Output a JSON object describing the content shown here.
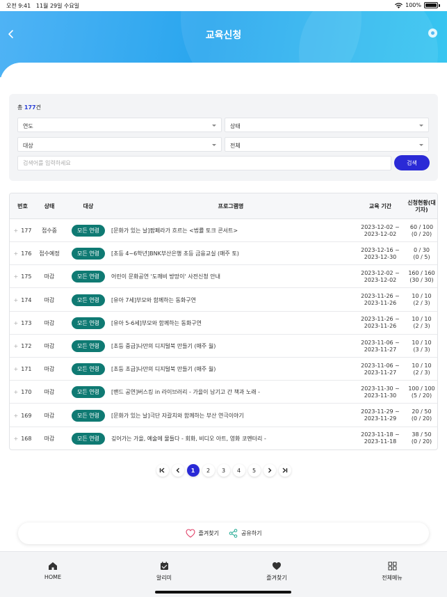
{
  "status_bar": {
    "time": "오전 9:41",
    "date": "11월 29일 수요일",
    "battery": "100%"
  },
  "header": {
    "title": "교육신청"
  },
  "filter": {
    "total_prefix": "총",
    "total_count": "177",
    "total_suffix": "건",
    "year_select": "연도",
    "status_select": "상태",
    "target_select": "대상",
    "all_select": "전체",
    "search_placeholder": "검색어를 입력하세요",
    "search_button": "검색"
  },
  "table": {
    "headers": {
      "no": "번호",
      "status": "상태",
      "target": "대상",
      "program": "프로그램명",
      "period": "교육 기간",
      "application": "신청현황(대기자)"
    },
    "rows": [
      {
        "no": "177",
        "status": "접수중",
        "target": "모든 연령",
        "title": "[문화가 있는 날]팝페라가 흐르는 <법률 토크 콘서트>",
        "start": "2023-12-02 ~",
        "end": "2023-12-02",
        "count": "60 / 100",
        "wait": "(0 / 20)"
      },
      {
        "no": "176",
        "status": "접수예정",
        "target": "모든 연령",
        "title": "[초등 4~6학년]BNK부산은행 초등 금융교실 (매주 토)",
        "start": "2023-12-16 ~",
        "end": "2023-12-30",
        "count": "0 / 30",
        "wait": "(0 / 5)"
      },
      {
        "no": "175",
        "status": "마감",
        "target": "모든 연령",
        "title": "어린이 문화공연 '도깨비 방망이' 사전신청 안내",
        "start": "2023-12-02 ~",
        "end": "2023-12-02",
        "count": "160 / 160",
        "wait": "(30 / 30)"
      },
      {
        "no": "174",
        "status": "마감",
        "target": "모든 연령",
        "title": "[유아 7세]부모와 함께하는 동화구연",
        "start": "2023-11-26 ~",
        "end": "2023-11-26",
        "count": "10 / 10",
        "wait": "(2 / 3)"
      },
      {
        "no": "173",
        "status": "마감",
        "target": "모든 연령",
        "title": "[유아 5-6세]부모와 함께하는 동화구연",
        "start": "2023-11-26 ~",
        "end": "2023-11-26",
        "count": "10 / 10",
        "wait": "(2 / 3)"
      },
      {
        "no": "172",
        "status": "마감",
        "target": "모든 연령",
        "title": "[초등 중급]나만의 디지털북 만들기 (매주 월)",
        "start": "2023-11-06 ~",
        "end": "2023-11-27",
        "count": "10 / 10",
        "wait": "(3 / 3)"
      },
      {
        "no": "171",
        "status": "마감",
        "target": "모든 연령",
        "title": "[초등 초급]나만의 디지털북 만들기 (매주 월)",
        "start": "2023-11-06 ~",
        "end": "2023-11-27",
        "count": "10 / 10",
        "wait": "(2 / 3)"
      },
      {
        "no": "170",
        "status": "마감",
        "target": "모든 연령",
        "title": "[밴드 공연]버스킹 in 라이브러리 - 가을이 남기고 간 책과 노래 -",
        "start": "2023-11-30 ~",
        "end": "2023-11-30",
        "count": "100 / 100",
        "wait": "(5 / 20)"
      },
      {
        "no": "169",
        "status": "마감",
        "target": "모든 연령",
        "title": "[문화가 있는 날]극단 자갈치와 함께하는 부산 연극이야기",
        "start": "2023-11-29 ~",
        "end": "2023-11-29",
        "count": "20 / 50",
        "wait": "(0 / 20)"
      },
      {
        "no": "168",
        "status": "마감",
        "target": "모든 연령",
        "title": "깊어가는 가을, 예술에 물들다 - 회화, 비디오 아트, 영화 코멘터리 -",
        "start": "2023-11-18 ~",
        "end": "2023-11-18",
        "count": "38 / 50",
        "wait": "(0 / 20)"
      }
    ]
  },
  "pagination": {
    "first": "|<",
    "prev": "<",
    "pages": [
      "1",
      "2",
      "3",
      "4",
      "5"
    ],
    "current": "1",
    "next": ">",
    "last": ">|"
  },
  "share_bar": {
    "favorite_label": "즐겨찾기",
    "share_label": "공유하기"
  },
  "bottom_nav": [
    {
      "label": "HOME",
      "icon": "home-icon"
    },
    {
      "label": "알리미",
      "icon": "calendar-icon"
    },
    {
      "label": "즐겨찾기",
      "icon": "heart-icon"
    },
    {
      "label": "전체메뉴",
      "icon": "grid-icon"
    }
  ],
  "colors": {
    "accent": "#2a2ad6",
    "badge": "#0f7a73",
    "header_start": "#4fb3f5",
    "header_end": "#38c6f0"
  }
}
